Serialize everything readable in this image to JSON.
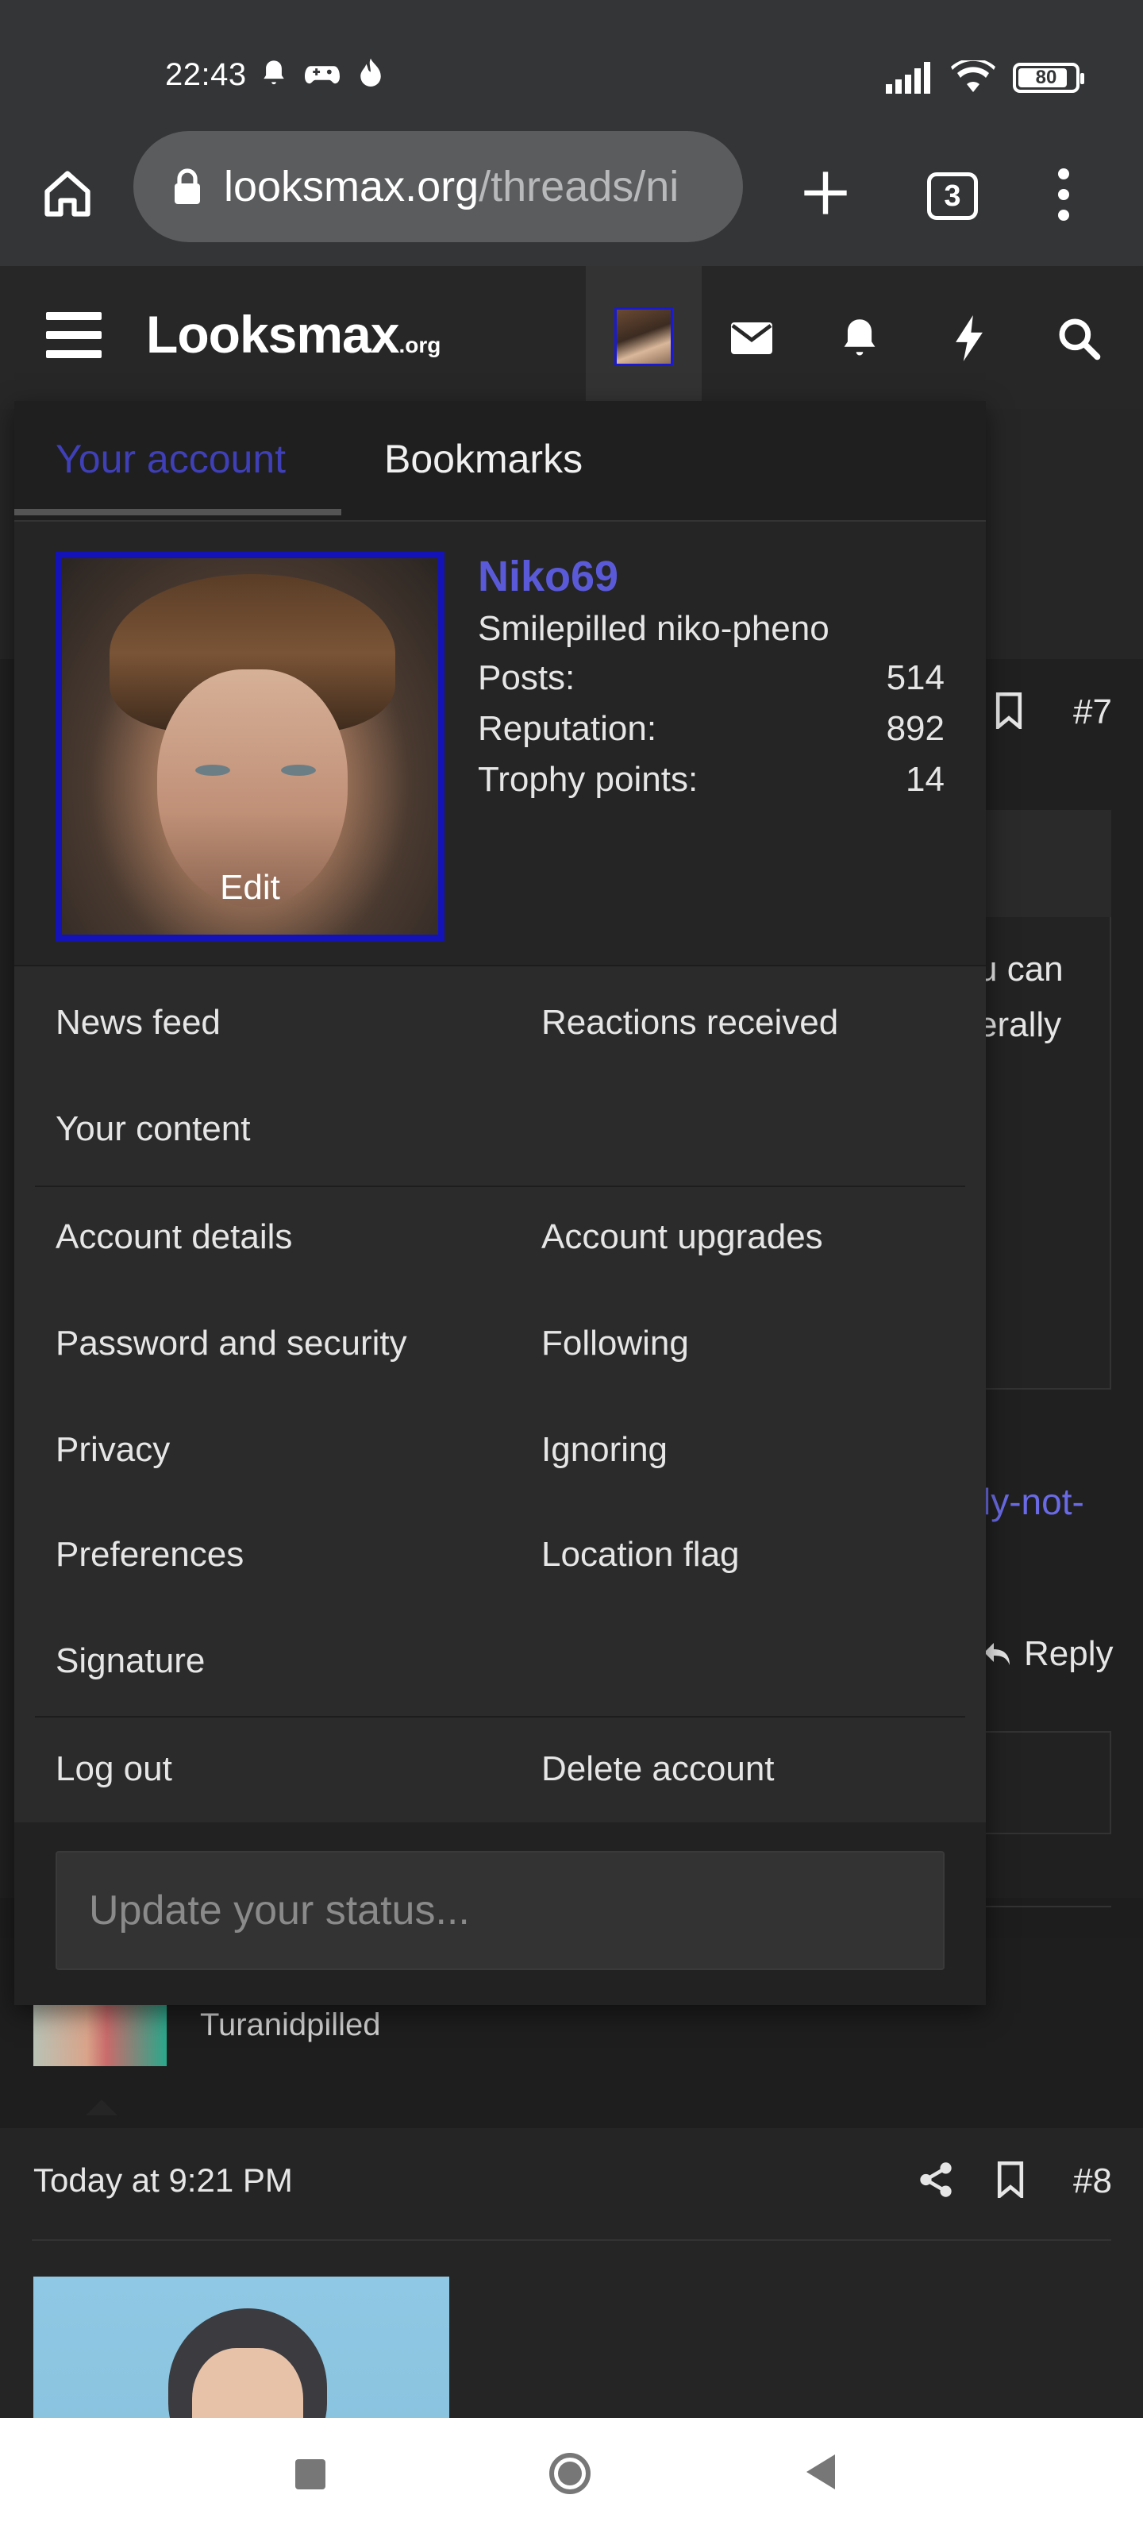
{
  "status_bar": {
    "time": "22:43",
    "battery": "80",
    "left_icons": [
      "bell-icon",
      "gamepad-icon",
      "flame-icon"
    ],
    "right_icons": [
      "signal-icon",
      "wifi-icon",
      "battery-icon"
    ]
  },
  "browser": {
    "url_host": "looksmax.org",
    "url_path": "/threads/ni",
    "tab_count": "3"
  },
  "site_header": {
    "logo_main": "Looksmax",
    "logo_suffix": ".org"
  },
  "account_menu": {
    "tabs": [
      {
        "label": "Your account",
        "active": true
      },
      {
        "label": "Bookmarks",
        "active": false
      }
    ],
    "profile": {
      "username": "Niko69",
      "user_title": "Smilepilled niko-pheno",
      "avatar_edit_label": "Edit",
      "stats": [
        {
          "label": "Posts:",
          "value": "514"
        },
        {
          "label": "Reputation:",
          "value": "892"
        },
        {
          "label": "Trophy points:",
          "value": "14"
        }
      ]
    },
    "links": {
      "news_feed": "News feed",
      "reactions_received": "Reactions received",
      "your_content": "Your content",
      "account_details": "Account details",
      "account_upgrades": "Account upgrades",
      "password_security": "Password and security",
      "following": "Following",
      "privacy": "Privacy",
      "ignoring": "Ignoring",
      "preferences": "Preferences",
      "location_flag": "Location flag",
      "signature": "Signature",
      "log_out": "Log out",
      "delete_account": "Delete account"
    },
    "status_placeholder": "Update your status..."
  },
  "background_page": {
    "post7_number": "#7",
    "text_fragment_1": "u can",
    "text_fragment_2": "erally",
    "link_fragment": "ly-not-",
    "reply_label": "Reply",
    "user_title_below": "Turanidpilled",
    "post8_timestamp": "Today at 9:21 PM",
    "post8_number": "#8"
  },
  "colors": {
    "accent_link": "#5a5ad8",
    "avatar_border": "#1313b8",
    "background": "#1b1b1b"
  }
}
